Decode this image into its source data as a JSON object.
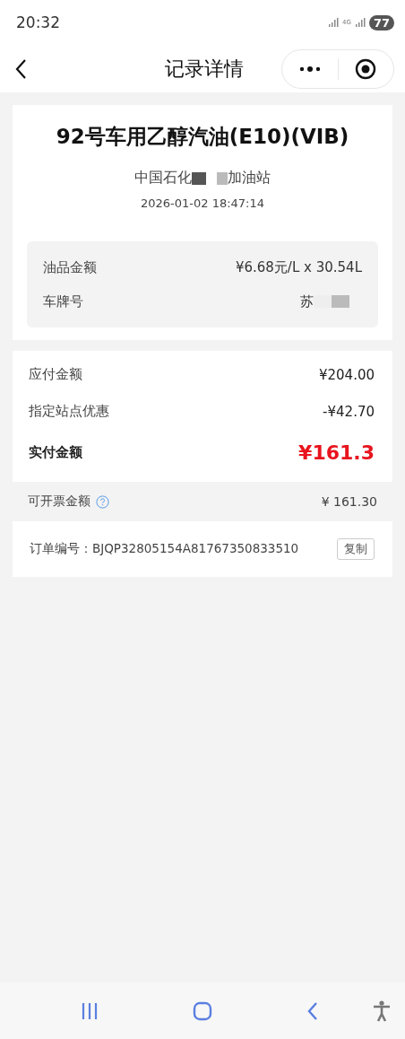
{
  "status_bar": {
    "time": "20:32",
    "network": "4G",
    "battery": "77"
  },
  "nav": {
    "title": "记录详情"
  },
  "fuel": {
    "title": "92号车用乙醇汽油(E10)(VIB)",
    "station_prefix": "中国石化",
    "station_suffix": "加油站",
    "datetime": "2026-01-02 18:47:14",
    "details": [
      {
        "label": "油品金额",
        "value": "¥6.68元/L x 30.54L",
        "masked": false
      },
      {
        "label": "车牌号",
        "value": "苏",
        "masked": true
      }
    ]
  },
  "payment": [
    {
      "label": "应付金额",
      "value": "¥204.00",
      "kind": "normal"
    },
    {
      "label": "指定站点优惠",
      "value": "-¥42.70",
      "kind": "normal"
    },
    {
      "label": "实付金额",
      "value": "¥161.3",
      "kind": "total"
    }
  ],
  "invoice": {
    "label": "可开票金额",
    "value": "¥ 161.30"
  },
  "order": {
    "label": "订单编号：BJQP32805154A81767350833510",
    "button": "复制"
  }
}
